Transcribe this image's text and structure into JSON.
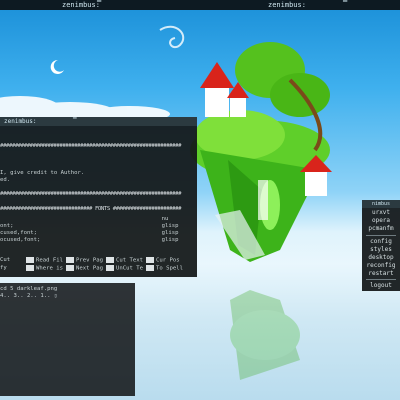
{
  "topbar": {
    "title_left": "zenimbus:",
    "title_right": "zenimbus:"
  },
  "terminal_top": {
    "title": "zenimbus:",
    "lines": [
      "#############################################################",
      "",
      "I, give credit to Author.",
      "ed.",
      "",
      "#############################################################",
      "",
      "############################### FONTS #######################",
      "",
      "                                                nu",
      "ont;                                            glisp",
      "cused,font;                                     glisp",
      "ocused,font;                                    glisp"
    ],
    "fkeys_row1": [
      "Cut",
      "Read Fil",
      "Prev Pag",
      "Cut Text",
      "Cur Pos"
    ],
    "fkeys_row2": [
      "fy",
      "Where is",
      "Next Pag",
      "UnCut Te",
      "To Spell"
    ]
  },
  "terminal_bottom": {
    "lines": [
      "cd 5 darkleaf.png",
      "4.. 3.. 2.. 1.. ▯"
    ]
  },
  "menu": {
    "header": "nimbus",
    "items": [
      "urxvt",
      "opera",
      "pcmanfm",
      "config",
      "styles",
      "desktop",
      "reconfig",
      "restart",
      "logout"
    ]
  },
  "colors": {
    "sky_top": "#1a8fd8",
    "horizon": "#e9f7fd",
    "terminal_bg": "#14181a",
    "titlebar": "#2b3a40"
  }
}
